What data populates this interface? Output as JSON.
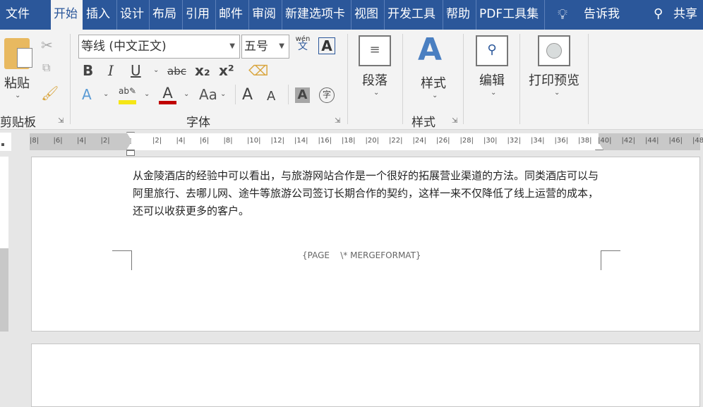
{
  "tabs": [
    "文件",
    "开始",
    "插入",
    "设计",
    "布局",
    "引用",
    "邮件",
    "审阅",
    "新建选项卡",
    "视图",
    "开发工具",
    "帮助",
    "PDF工具集"
  ],
  "tell_me": "告诉我",
  "share": "共享",
  "clipboard": {
    "paste": "粘贴",
    "group": "剪贴板"
  },
  "font": {
    "name": "等线 (中文正文)",
    "size": "五号",
    "group": "字体",
    "phonetic_top": "wén",
    "phonetic_bottom": "文",
    "bold": "B",
    "italic": "I",
    "underline": "U",
    "strike": "abc",
    "sub": "x₂",
    "sup": "x²",
    "case": "Aa",
    "grow": "A",
    "shrink": "A",
    "shade": "A",
    "char_border": "A",
    "enclose": "字"
  },
  "paragraph": {
    "label": "段落"
  },
  "styles": {
    "label": "样式",
    "group": "样式"
  },
  "editing": {
    "label": "编辑"
  },
  "print": {
    "label": "打印预览"
  },
  "ruler": {
    "left": [
      "8",
      "6",
      "4",
      "2"
    ],
    "main": [
      "2",
      "4",
      "6",
      "8",
      "10",
      "12",
      "14",
      "16",
      "18",
      "20",
      "22",
      "24",
      "26",
      "28",
      "30",
      "32",
      "34",
      "36",
      "38"
    ],
    "right": [
      "40",
      "42",
      "44",
      "46",
      "48"
    ]
  },
  "document": {
    "text": "从金陵酒店的经验中可以看出，与旅游网站合作是一个很好的拓展营业渠道的方法。同类酒店可以与阿里旅行、去哪儿网、途牛等旅游公司签订长期合作的契约，这样一来不仅降低了线上运营的成本，还可以收获更多的客户。",
    "footer_field": "{PAGE    \\* MERGEFORMAT}"
  },
  "colors": {
    "accent": "#2b579a",
    "highlight": "#f5e616",
    "font_color": "#c00000"
  }
}
